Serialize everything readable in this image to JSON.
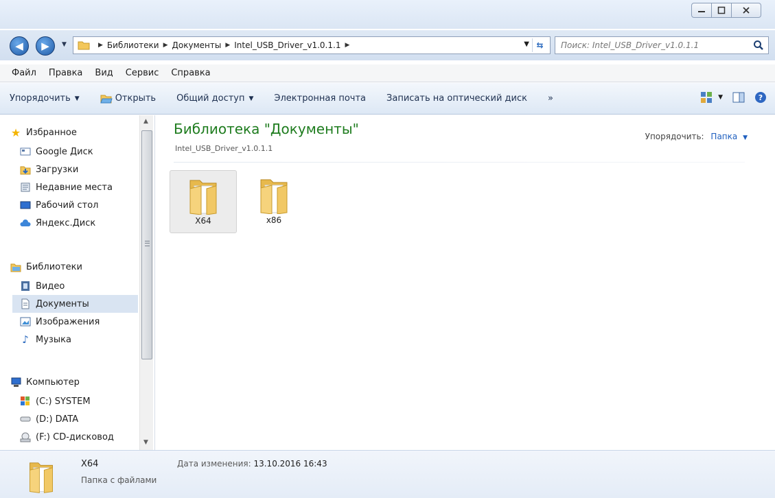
{
  "window": {
    "minimize_label": "▭",
    "maximize_label": "□",
    "close_label": "✕"
  },
  "address": {
    "crumbs": [
      "Библиотеки",
      "Документы",
      "Intel_USB_Driver_v1.0.1.1"
    ],
    "search_placeholder": "Поиск: Intel_USB_Driver_v1.0.1.1"
  },
  "menu": [
    "Файл",
    "Правка",
    "Вид",
    "Сервис",
    "Справка"
  ],
  "toolbar": {
    "organize": "Упорядочить",
    "open": "Открыть",
    "share": "Общий доступ",
    "email": "Электронная почта",
    "burn": "Записать на оптический диск",
    "more": "»"
  },
  "nav": {
    "favorites_header": "Избранное",
    "favorites": [
      "Google Диск",
      "Загрузки",
      "Недавние места",
      "Рабочий стол",
      "Яндекс.Диск"
    ],
    "libraries_header": "Библиотеки",
    "libraries": [
      "Видео",
      "Документы",
      "Изображения",
      "Музыка"
    ],
    "computer_header": "Компьютер",
    "drives": [
      "(C:) SYSTEM",
      "(D:) DATA",
      "(F:) CD-дисковод"
    ]
  },
  "content": {
    "title": "Библиотека \"Документы\"",
    "subtitle": "Intel_USB_Driver_v1.0.1.1",
    "arrange_label": "Упорядочить:",
    "arrange_value": "Папка",
    "items": [
      "X64",
      "x86"
    ]
  },
  "details": {
    "name": "X64",
    "type": "Папка с файлами",
    "date_label": "Дата изменения:",
    "date_value": "13.10.2016 16:43"
  },
  "colors": {
    "title_green": "#1e7c1e",
    "link_blue": "#1f5fbf",
    "selection": "#d9e4f2"
  }
}
